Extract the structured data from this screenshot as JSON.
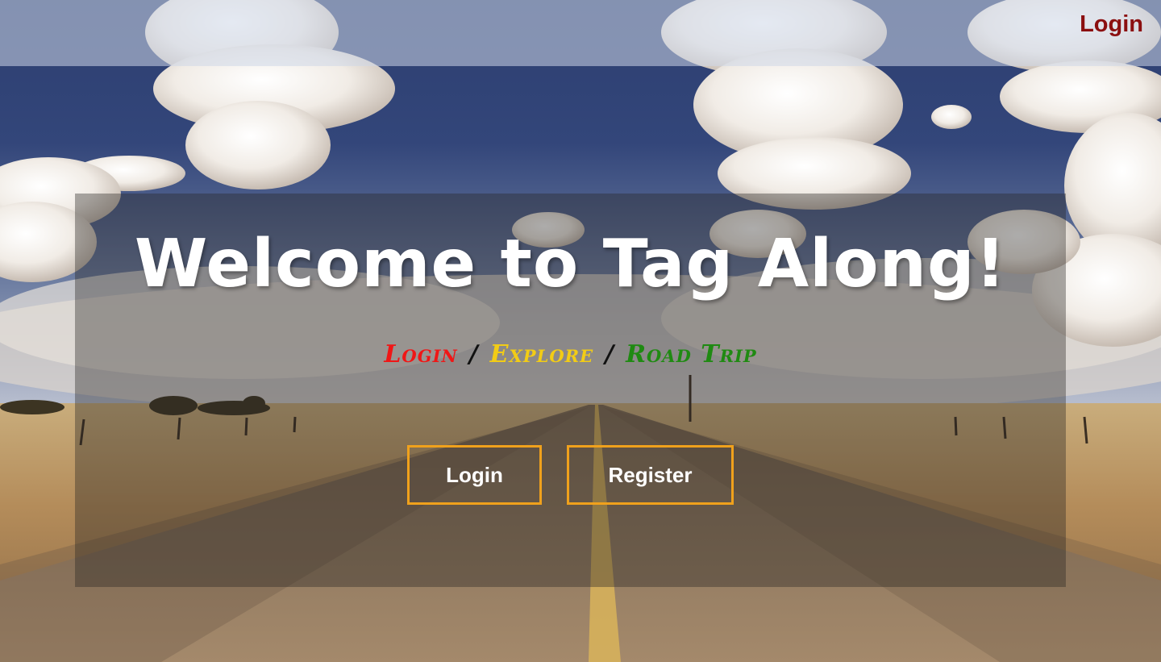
{
  "nav": {
    "login_label": "Login"
  },
  "hero": {
    "title": "Welcome to Tag Along!",
    "tagline": {
      "login": "Login",
      "explore": "Explore",
      "road_trip": "Road Trip",
      "separator": "/"
    },
    "login_button": "Login",
    "register_button": "Register"
  },
  "colors": {
    "nav_login": "#8b0f10",
    "tag_login": "#f01616",
    "tag_explore": "#f2cc15",
    "tag_road_trip": "#1f8a12",
    "button_border": "#f0a11c"
  }
}
